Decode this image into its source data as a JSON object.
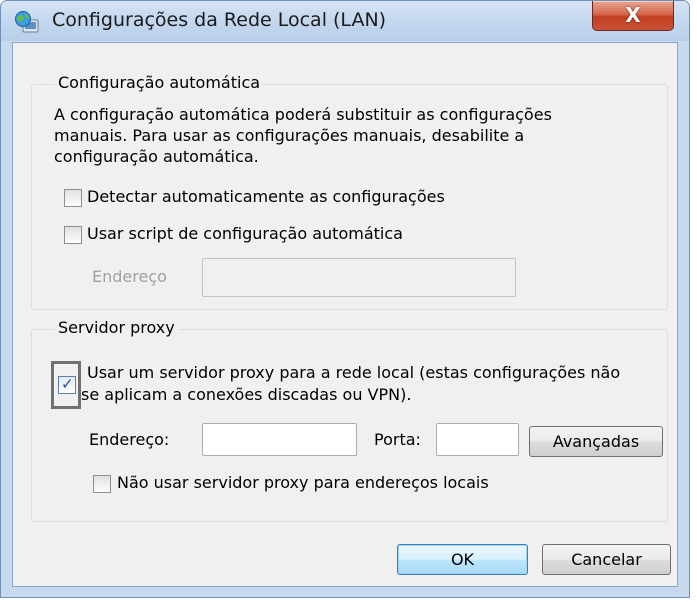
{
  "window": {
    "title": "Configurações da Rede Local (LAN)",
    "icon": "network-globe-icon",
    "close_label": "X"
  },
  "auto_config": {
    "legend": "Configuração automática",
    "description": [
      "A configuração automática poderá substituir as configurações",
      "manuais. Para usar as configurações manuais, desabilite a",
      "configuração automática."
    ],
    "detect_label": "Detectar automaticamente as configurações",
    "detect_checked": false,
    "script_label": "Usar script de configuração automática",
    "script_checked": false,
    "address_label": "Endereço",
    "address_value": ""
  },
  "proxy": {
    "legend": "Servidor proxy",
    "use_proxy_label_line1": "Usar um servidor proxy para a rede local (estas configurações não",
    "use_proxy_label_line2": "se aplicam a conexões discadas ou VPN).",
    "use_proxy_checked": true,
    "address_label": "Endereço:",
    "address_value": "",
    "port_label": "Porta:",
    "port_value": "",
    "advanced_label": "Avançadas",
    "bypass_label": "Não usar servidor proxy para endereços locais",
    "bypass_checked": false
  },
  "buttons": {
    "ok_label": "OK",
    "cancel_label": "Cancelar"
  }
}
